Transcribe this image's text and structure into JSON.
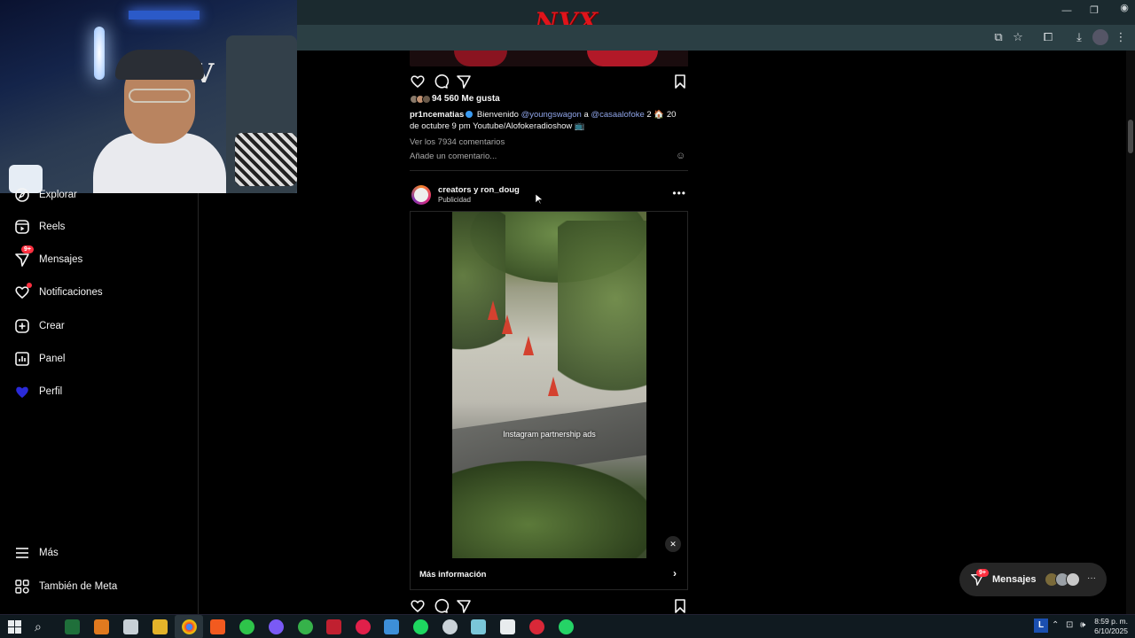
{
  "browser": {
    "logo_text": "NVX"
  },
  "sidebar": {
    "items": [
      {
        "label": "Explorar",
        "icon": "compass-icon"
      },
      {
        "label": "Reels",
        "icon": "reels-icon"
      },
      {
        "label": "Mensajes",
        "icon": "messenger-icon",
        "badge": "9+"
      },
      {
        "label": "Notificaciones",
        "icon": "heart-icon"
      },
      {
        "label": "Crear",
        "icon": "plus-square-icon"
      },
      {
        "label": "Panel",
        "icon": "chart-icon"
      },
      {
        "label": "Perfil",
        "icon": "profile-avatar"
      }
    ],
    "bottom_items": [
      {
        "label": "Más",
        "icon": "menu-icon"
      },
      {
        "label": "También de Meta",
        "icon": "meta-grid-icon"
      }
    ]
  },
  "post1": {
    "likes": "94 560 Me gusta",
    "caption_user": "pr1ncematias",
    "caption_parts": [
      "Bienvenido",
      "@youngswagon",
      "a",
      "@casaalofoke",
      "2 🏠 20 de octubre 9 pm Youtube/Alofokeradioshow 📺"
    ],
    "view_comments": "Ver los 7934 comentarios",
    "add_comment_placeholder": "Añade un comentario...",
    "emoji_icon": "smiley-icon"
  },
  "post2": {
    "username": "creators y ron_doug",
    "subtitle": "Publicidad",
    "video_caption": "Instagram partnership ads",
    "more_info": "Más información"
  },
  "messages_pill": {
    "label": "Mensajes",
    "badge": "9+"
  },
  "taskbar": {
    "time": "8:59 p. m.",
    "date": "6/10/2025",
    "lang": "L"
  },
  "colors": {
    "instagram_bg": "#000000",
    "notification_red": "#ff3040",
    "mention_blue": "#8fa4e8",
    "browser_bar": "#1b2a2f",
    "logo_red": "#e0141b"
  }
}
